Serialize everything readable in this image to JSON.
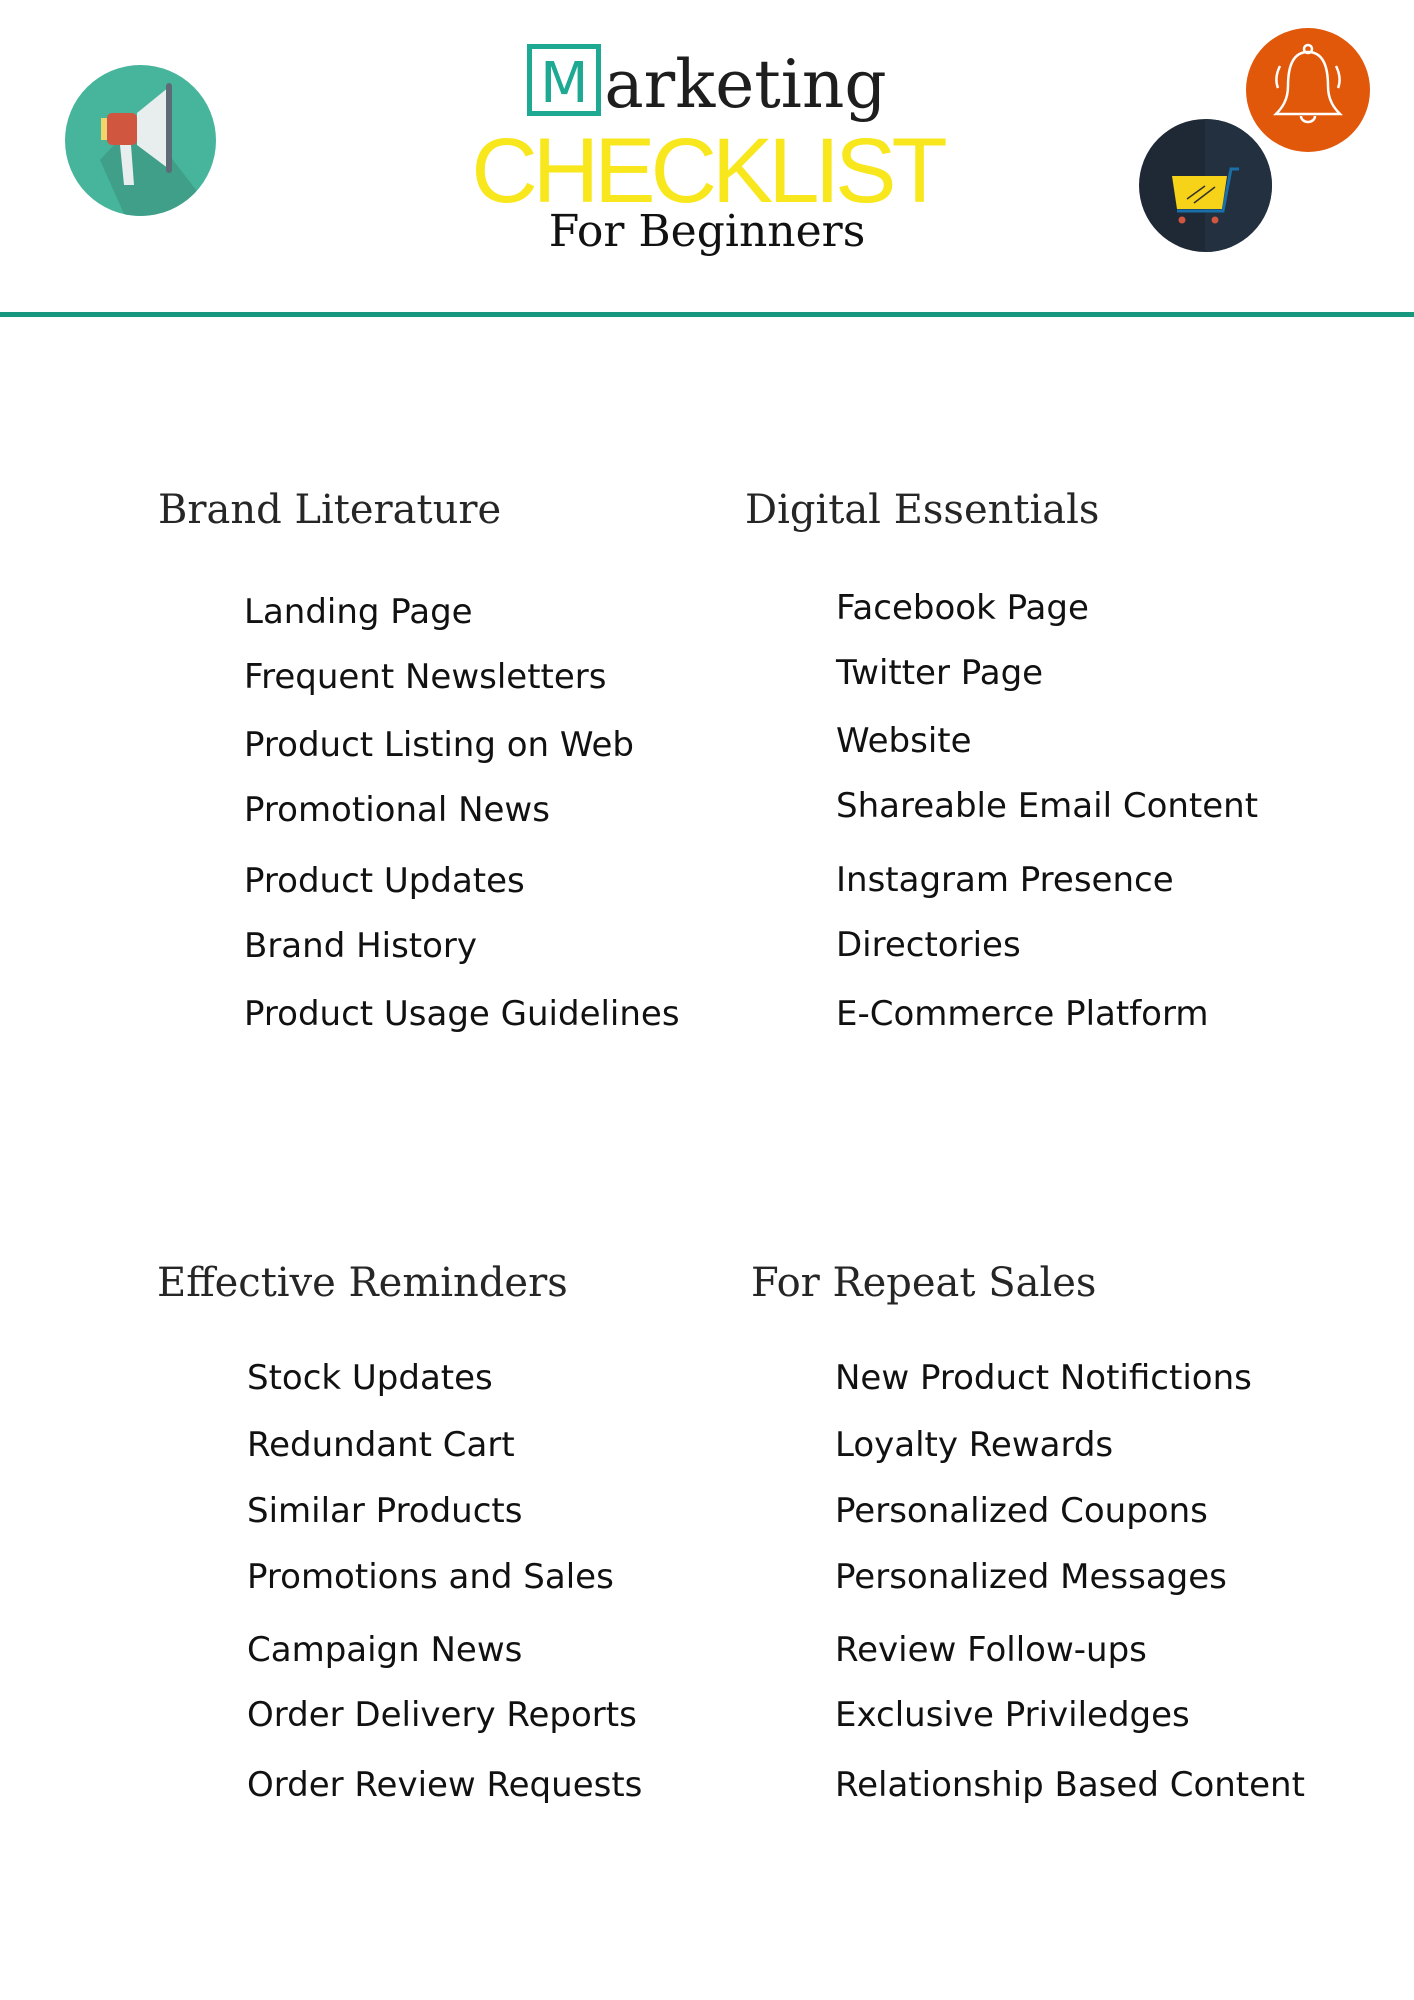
{
  "header": {
    "title_initial": "M",
    "title_rest": "arketing",
    "title_emphasis": "CHECKLIST",
    "subtitle": "For Beginners",
    "icons": [
      "megaphone-icon",
      "bell-icon",
      "shopping-cart-icon"
    ]
  },
  "colors": {
    "accent_teal": "#1ea992",
    "rule_teal": "#16977e",
    "checklist_yellow": "#f8e71c",
    "megaphone_bg": "#46b59b",
    "bell_bg": "#e2580a",
    "cart_bg": "#1f2936"
  },
  "sections": [
    {
      "heading": "Brand Literature",
      "items": [
        "Landing Page",
        "Frequent Newsletters",
        "Product Listing on Web",
        "Promotional News",
        "Product Updates",
        "Brand History",
        "Product Usage Guidelines"
      ]
    },
    {
      "heading": "Digital Essentials",
      "items": [
        "Facebook Page",
        "Twitter Page",
        "Website",
        "Shareable Email Content",
        "Instagram Presence",
        "Directories",
        "E-Commerce Platform"
      ]
    },
    {
      "heading": "Effective Reminders",
      "items": [
        "Stock Updates",
        "Redundant Cart",
        "Similar Products",
        "Promotions and Sales",
        "Campaign News",
        "Order Delivery Reports",
        "Order Review Requests"
      ]
    },
    {
      "heading": "For Repeat Sales",
      "items": [
        "New Product Notifictions",
        "Loyalty Rewards",
        "Personalized Coupons",
        "Personalized Messages",
        "Review Follow-ups",
        "Exclusive Priviledges",
        "Relationship Based Content"
      ]
    }
  ]
}
